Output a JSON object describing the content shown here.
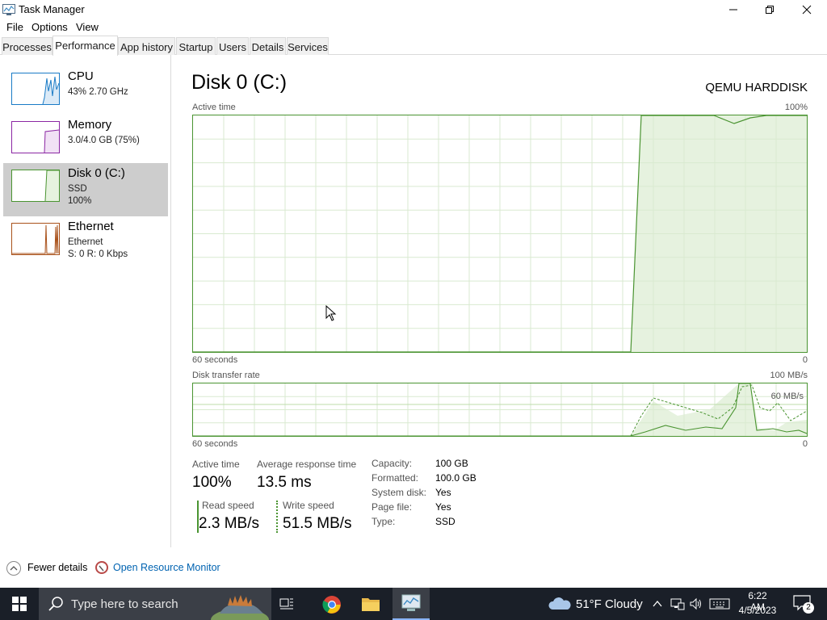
{
  "window": {
    "title": "Task Manager"
  },
  "menu": [
    "File",
    "Options",
    "View"
  ],
  "tabs": [
    "Processes",
    "Performance",
    "App history",
    "Startup",
    "Users",
    "Details",
    "Services"
  ],
  "active_tab": "Performance",
  "sidebar": [
    {
      "title": "CPU",
      "line1": "43% 2.70 GHz",
      "color": "#1a7bc6"
    },
    {
      "title": "Memory",
      "line1": "3.0/4.0 GB (75%)",
      "color": "#8b27a3"
    },
    {
      "title": "Disk 0 (C:)",
      "line1": "SSD",
      "line2": "100%",
      "color": "#4a9431"
    },
    {
      "title": "Ethernet",
      "line1": "Ethernet",
      "line2": "S: 0 R: 0 Kbps",
      "color": "#a9511a"
    }
  ],
  "main": {
    "title": "Disk 0 (C:)",
    "device": "QEMU HARDDISK",
    "graph1": {
      "label": "Active time",
      "max_label": "100%",
      "time_label": "60 seconds",
      "min_label": "0"
    },
    "graph2": {
      "label": "Disk transfer rate",
      "max_label": "100 MB/s",
      "mid_label": "60 MB/s",
      "time_label": "60 seconds",
      "min_label": "0"
    },
    "stats": {
      "active_time_label": "Active time",
      "active_time_value": "100%",
      "avg_resp_label": "Average response time",
      "avg_resp_value": "13.5 ms",
      "read_label": "Read speed",
      "read_value": "2.3 MB/s",
      "write_label": "Write speed",
      "write_value": "51.5 MB/s"
    },
    "info": [
      {
        "key": "Capacity:",
        "value": "100 GB"
      },
      {
        "key": "Formatted:",
        "value": "100.0 GB"
      },
      {
        "key": "System disk:",
        "value": "Yes"
      },
      {
        "key": "Page file:",
        "value": "Yes"
      },
      {
        "key": "Type:",
        "value": "SSD"
      }
    ]
  },
  "footer": {
    "fewer_details": "Fewer details",
    "resource_monitor": "Open Resource Monitor"
  },
  "taskbar": {
    "search_placeholder": "Type here to search",
    "weather": "51°F  Cloudy",
    "time": "6:22 AM",
    "date": "4/5/2023",
    "notification_count": "2"
  },
  "colors": {
    "disk_green": "#4a9431",
    "disk_fill": "#e6f2df",
    "link_blue": "#0063b1",
    "taskbar_bg": "#1a1f28"
  }
}
